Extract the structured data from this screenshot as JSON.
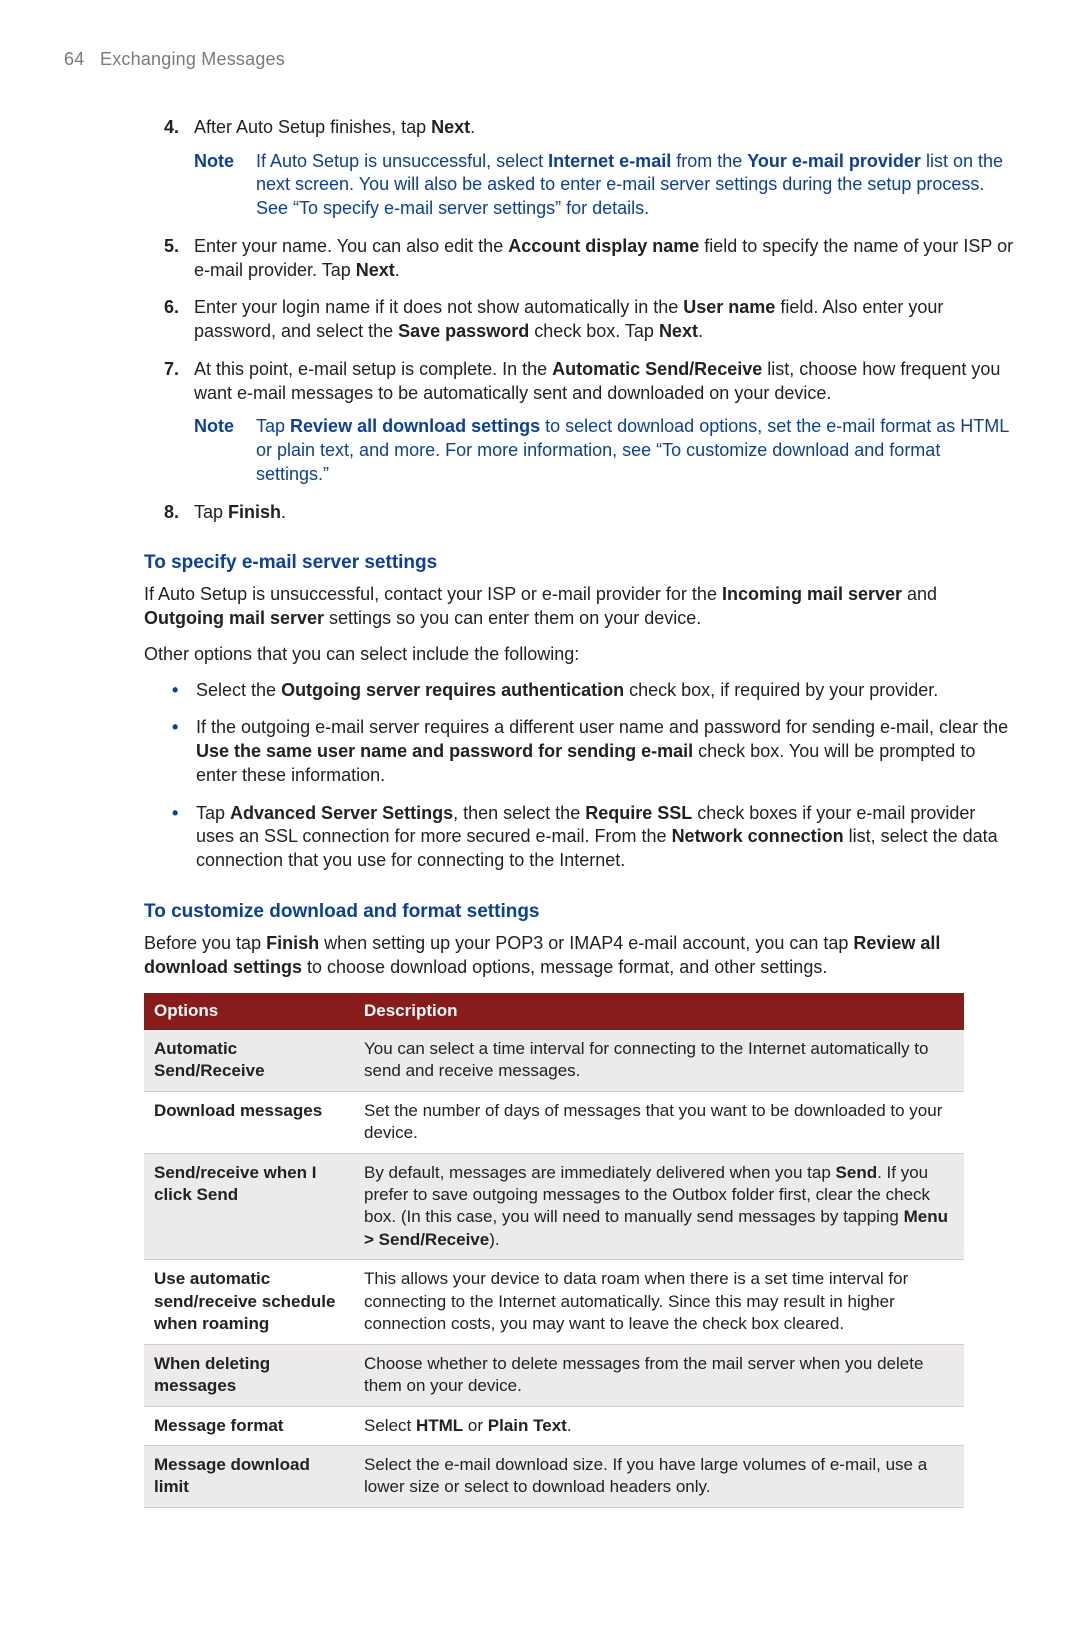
{
  "page": {
    "number": "64",
    "title": "Exchanging Messages"
  },
  "steps": [
    {
      "n": "4.",
      "parts": [
        "After Auto Setup finishes, tap ",
        "Next",
        "."
      ]
    },
    {
      "n": "5.",
      "parts": [
        "Enter your name. You can also edit the ",
        "Account display name",
        " field to specify the name of your ISP or e-mail provider. Tap ",
        "Next",
        "."
      ]
    },
    {
      "n": "6.",
      "parts": [
        "Enter your login name if it does not show automatically in the ",
        "User name",
        " field. Also enter your password, and select the ",
        "Save password",
        " check box. Tap ",
        "Next",
        "."
      ]
    },
    {
      "n": "7.",
      "parts": [
        "At this point, e-mail setup is complete. In the ",
        "Automatic Send/Receive",
        " list, choose how frequent you want e-mail messages to be automatically sent and downloaded on your device."
      ]
    },
    {
      "n": "8.",
      "parts": [
        "Tap ",
        "Finish",
        "."
      ]
    }
  ],
  "notes": {
    "label": "Note",
    "n1_parts": [
      "If Auto Setup is unsuccessful, select ",
      "Internet e-mail",
      " from the ",
      "Your e-mail provider",
      " list on the next screen. You will also be asked to enter e-mail server settings during the setup process. See “To specify e-mail server settings” for details."
    ],
    "n2_parts": [
      "Tap ",
      "Review all download settings",
      " to select download options, set the e-mail format as HTML or plain text, and more. For more information, see “To customize download and format settings.”"
    ]
  },
  "sec1": {
    "head": "To specify e-mail server settings",
    "p1_parts": [
      "If Auto Setup is unsuccessful, contact your ISP or e-mail provider for the ",
      "Incoming mail server",
      " and ",
      "Outgoing mail server",
      " settings so you can enter them on your device."
    ],
    "p2": "Other options that you can select include the following:",
    "bullets": [
      {
        "parts": [
          "Select the ",
          "Outgoing server requires authentication",
          " check box, if required by your provider."
        ]
      },
      {
        "parts": [
          "If the outgoing e-mail server requires a different user name and password for sending e-mail, clear the ",
          "Use the same user name and password for sending e-mail",
          " check box. You will be prompted to enter these information."
        ]
      },
      {
        "parts": [
          "Tap ",
          "Advanced Server Settings",
          ", then select the ",
          "Require SSL",
          " check boxes if your e-mail provider uses an SSL connection for more secured e-mail. From the ",
          "Network connection",
          " list, select the data connection that you use for connecting to the Internet."
        ]
      }
    ]
  },
  "sec2": {
    "head": "To customize download and format settings",
    "p1_parts": [
      "Before you tap ",
      "Finish",
      " when setting up your POP3 or IMAP4 e-mail account, you can tap ",
      "Review all download settings",
      " to choose download options, message format, and other settings."
    ]
  },
  "table": {
    "headers": [
      "Options",
      "Description"
    ],
    "rows": [
      {
        "opt": "Automatic Send/Receive",
        "desc_parts": [
          "You can select a time interval for connecting to the Internet automatically to send and receive messages."
        ]
      },
      {
        "opt": "Download messages",
        "desc_parts": [
          "Set the number of days of messages that you want to be downloaded to your device."
        ]
      },
      {
        "opt": "Send/receive when I click Send",
        "desc_parts": [
          "By default, messages are immediately delivered when you tap ",
          "Send",
          ". If you prefer to save outgoing messages to the Outbox folder first, clear the check box. (In this case, you will need to manually send messages by tapping ",
          "Menu > Send/Receive",
          ")."
        ]
      },
      {
        "opt": "Use automatic send/receive schedule when roaming",
        "desc_parts": [
          "This allows your device to data roam when there is a set time interval for connecting to the Internet automatically. Since this may result in higher connection costs, you may want to leave the check box cleared."
        ]
      },
      {
        "opt": "When deleting messages",
        "desc_parts": [
          "Choose whether to delete messages from the mail server when you delete them on your device."
        ]
      },
      {
        "opt": "Message format",
        "desc_parts": [
          "Select ",
          "HTML",
          " or ",
          "Plain Text",
          "."
        ]
      },
      {
        "opt": "Message download limit",
        "desc_parts": [
          "Select the e-mail download size. If you have large volumes of e-mail, use a lower size or select to download headers only."
        ]
      }
    ]
  }
}
